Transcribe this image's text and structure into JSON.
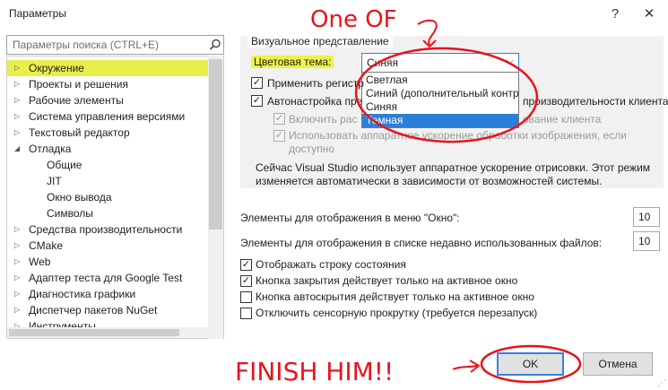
{
  "window": {
    "title": "Параметры",
    "help_glyph": "?",
    "close_glyph": "✕"
  },
  "search": {
    "placeholder": "Параметры поиска (CTRL+E)"
  },
  "tree": {
    "items": [
      {
        "label": "Окружение",
        "level": 0,
        "expanded": false,
        "selected": true
      },
      {
        "label": "Проекты и решения",
        "level": 0,
        "expanded": false
      },
      {
        "label": "Рабочие элементы",
        "level": 0,
        "expanded": false
      },
      {
        "label": "Система управления версиями",
        "level": 0,
        "expanded": false
      },
      {
        "label": "Текстовый редактор",
        "level": 0,
        "expanded": false
      },
      {
        "label": "Отладка",
        "level": 0,
        "expanded": true
      },
      {
        "label": "Общие",
        "level": 1
      },
      {
        "label": "JIT",
        "level": 1
      },
      {
        "label": "Окно вывода",
        "level": 1
      },
      {
        "label": "Символы",
        "level": 1
      },
      {
        "label": "Средства производительности",
        "level": 0,
        "expanded": false
      },
      {
        "label": "CMake",
        "level": 0,
        "expanded": false
      },
      {
        "label": "Web",
        "level": 0,
        "expanded": false
      },
      {
        "label": "Адаптер теста для Google Test",
        "level": 0,
        "expanded": false
      },
      {
        "label": "Диагностика графики",
        "level": 0,
        "expanded": false
      },
      {
        "label": "Диспетчер пакетов NuGet",
        "level": 0,
        "expanded": false
      },
      {
        "label": "Инструменты ...",
        "level": 0,
        "expanded": false
      }
    ]
  },
  "visual": {
    "group_title": "Визуальное представление",
    "theme_label": "Цветовая тема:",
    "theme_value": "Синяя",
    "theme_options": [
      "Светлая",
      "Синий (дополнительный контр",
      "Синяя",
      "Темная"
    ],
    "highlighted_option": "Темная",
    "apply_register": "Применить регистр",
    "auto_adjust_a": "Автонастройка пре",
    "auto_adjust_b": "производительности клиента",
    "enable_rich_a": "Включить рас",
    "enable_rich_b": "ование клиента",
    "hw_accel_a": "Использовать аппаратное ускорение обработки изображения, если",
    "hw_accel_b": "доступно",
    "info_line1": "Сейчас Visual Studio использует аппаратное ускорение отрисовки. Этот режим",
    "info_line2": "изменяется автоматически в зависимости от возможностей системы."
  },
  "window_menu": {
    "label": "Элементы для отображения в меню \"Окно\":",
    "value": "10"
  },
  "mru": {
    "label": "Элементы для отображения в списке недавно использованных файлов:",
    "value": "10"
  },
  "checks": [
    {
      "label": "Отображать строку состояния",
      "checked": true
    },
    {
      "label": "Кнопка закрытия действует только на активное окно",
      "checked": true
    },
    {
      "label": "Кнопка автоскрытия действует только на активное окно",
      "checked": false
    },
    {
      "label": "Отключить сенсорную прокрутку (требуется перезапуск)",
      "checked": false
    }
  ],
  "buttons": {
    "ok": "OK",
    "cancel": "Отмена"
  },
  "annotations": {
    "one_of": "One OF",
    "finish": "FINISH HIM!!"
  },
  "colors": {
    "highlight": "#e9ef4a",
    "annotation": "#e8141c",
    "accent": "#2b7fd8"
  }
}
